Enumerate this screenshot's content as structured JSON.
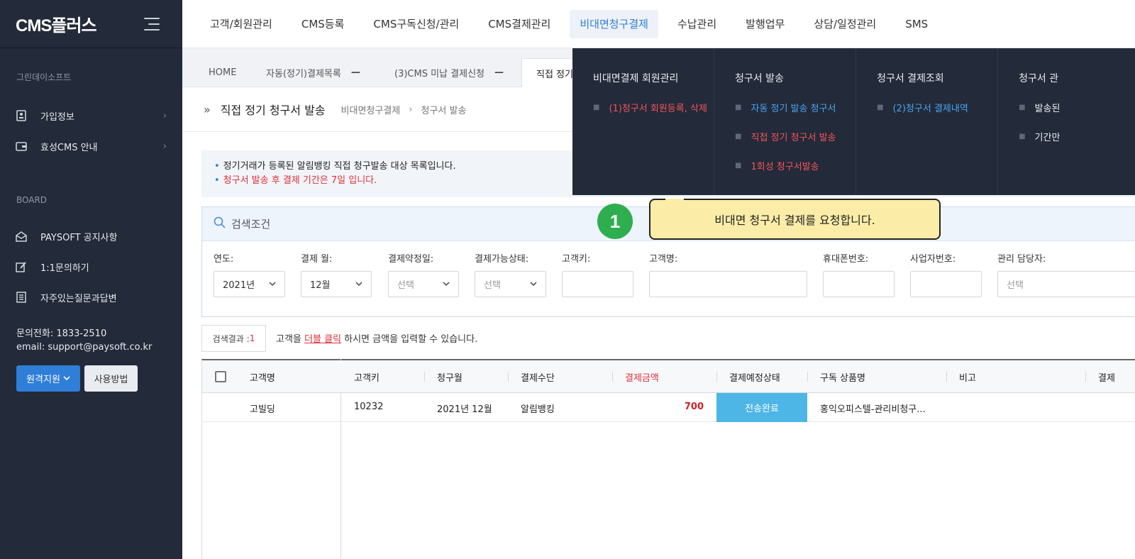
{
  "sidebar": {
    "logo": "CMS플러스",
    "company": "그린데이소프트",
    "items": [
      {
        "label": "가입정보"
      },
      {
        "label": "효성CMS 안내"
      }
    ],
    "board_title": "BOARD",
    "board_items": [
      {
        "label": "PAYSOFT 공지사항"
      },
      {
        "label": "1:1문의하기"
      },
      {
        "label": "자주있는질문과답변"
      }
    ],
    "phone": "문의전화: 1833-2510",
    "email": "email: support@paysoft.co.kr",
    "remote_label": "원격지원",
    "howto_label": "사용방법"
  },
  "topnav": {
    "items": [
      {
        "label": "고객/회원관리"
      },
      {
        "label": "CMS등록"
      },
      {
        "label": "CMS구독신청/관리"
      },
      {
        "label": "CMS결제관리"
      },
      {
        "label": "비대면청구결제"
      },
      {
        "label": "수납관리"
      },
      {
        "label": "발행업무"
      },
      {
        "label": "상담/일정관리"
      },
      {
        "label": "SMS"
      }
    ],
    "active_index": 4
  },
  "tabs": {
    "home": "HOME",
    "tab1": "자동(정기)결제목록",
    "tab2": "(3)CMS 미납 결제신청",
    "tab3": "직접 정기"
  },
  "page": {
    "title": "직접 정기 청구서 발송",
    "crumb1": "비대면청구결제",
    "crumb2": "청구서 발송"
  },
  "info": {
    "line1": "정기거래가 등록된 알림뱅킹 직접 청구발송 대상 목록입니다.",
    "line2": "청구서 발송 후 결제 기간은 7일 입니다."
  },
  "search": {
    "title": "검색조건",
    "fields": {
      "year_label": "연도:",
      "year_value": "2021년",
      "month_label": "결제 월:",
      "month_value": "12월",
      "promise_label": "결제약정일:",
      "promise_value": "선택",
      "status_label": "결제가능상태:",
      "status_value": "선택",
      "key_label": "고객키:",
      "name_label": "고객명:",
      "phone_label": "휴대폰번호:",
      "biz_label": "사업자번호:",
      "manager_label": "관리 담당자:",
      "manager_value": "선택"
    }
  },
  "result": {
    "label": "검색결과 : ",
    "count": "1",
    "hint_pre": "고객을 ",
    "hint_link": "더블 클릭",
    "hint_post": " 하시면 금액을 입력할 수 있습니다."
  },
  "table": {
    "headers": {
      "name": "고객명",
      "key": "고객키",
      "month": "청구월",
      "method": "결제수단",
      "amount": "결제금액",
      "status": "결제예정상태",
      "product": "구독 상품명",
      "note": "비고",
      "extra": "결제"
    },
    "rows": [
      {
        "name": "고빌딩",
        "key": "10232",
        "month": "2021년 12월",
        "method": "알림뱅킹",
        "amount": "700",
        "status": "전송완료",
        "product": "홍익오피스텔-관리비청구..."
      }
    ]
  },
  "mega": {
    "col1": {
      "title": "비대면결제 회원관리",
      "links": [
        "(1)청구서 회원등록, 삭제"
      ]
    },
    "col2": {
      "title": "청구서 발송",
      "links": [
        "자동 정기 발송 청구서",
        "직접 정기 청구서 발송",
        "1회성 청구서발송"
      ]
    },
    "col3": {
      "title": "청구서 결제조회",
      "links": [
        "(2)청구서 결제내역"
      ]
    },
    "col4": {
      "title": "청구서 관",
      "links": [
        "발송된",
        "기간만"
      ]
    }
  },
  "callout": {
    "badge": "1",
    "text": "비대면 청구서 결제를 요청합니다."
  },
  "colors": {
    "sidebar_bg": "#232a39",
    "accent_blue": "#2f7ed8",
    "accent_red": "#e0303a",
    "status_blue": "#4db6e6",
    "badge_green": "#2fae4f",
    "callout_yellow": "#fbeda8"
  }
}
